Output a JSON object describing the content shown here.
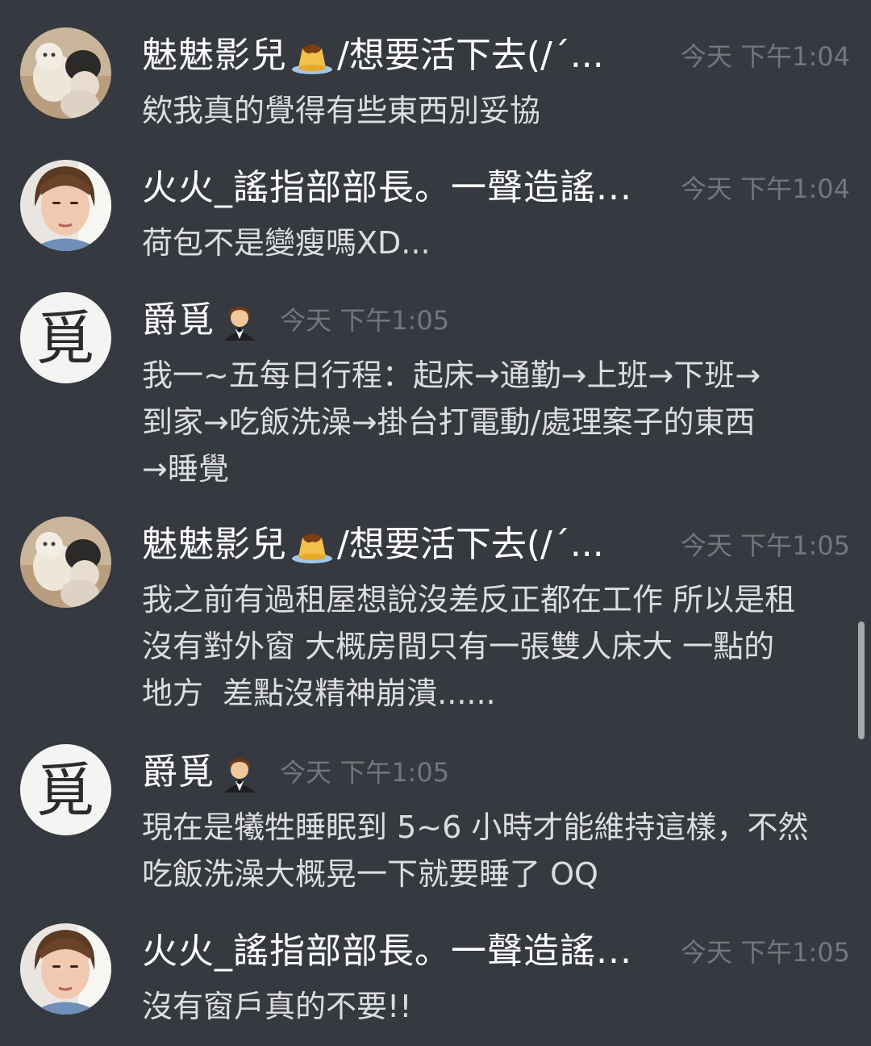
{
  "messages": [
    {
      "username": "魅魅影兒",
      "username_emoji": "pudding-emoji",
      "username_tail": " /想要活下去(/´...",
      "timestamp": "今天 下午1:04",
      "text": "欸我真的覺得有些東西別妥協",
      "avatar": "cats-avatar"
    },
    {
      "username": "火火_謠指部部長。一聲造謠...",
      "timestamp": "今天 下午1:04",
      "text": "荷包不是變瘦嗎XD...",
      "avatar": "woman-avatar"
    },
    {
      "username": "爵覓",
      "username_emoji": "man-in-tuxedo-emoji",
      "timestamp": "今天 下午1:05",
      "text": "我一~五每日行程：起床→通勤→上班→下班→\n到家→吃飯洗澡→掛台打電動/處理案子的東西\n→睡覺",
      "avatar": "calligraphy-avatar",
      "avatar_glyph": "覓"
    },
    {
      "username": "魅魅影兒",
      "username_emoji": "pudding-emoji",
      "username_tail": " /想要活下去(/´...",
      "timestamp": "今天 下午1:05",
      "text": "我之前有過租屋想說沒差反正都在工作 所以是租\n沒有對外窗 大概房間只有一張雙人床大 一點的\n地方  差點沒精神崩潰......",
      "avatar": "cats-avatar"
    },
    {
      "username": "爵覓",
      "username_emoji": "man-in-tuxedo-emoji",
      "timestamp": "今天 下午1:05",
      "text": "現在是犧牲睡眠到 5~6 小時才能維持這樣，不然\n吃飯洗澡大概晃一下就要睡了 OQ",
      "avatar": "calligraphy-avatar",
      "avatar_glyph": "覓"
    },
    {
      "username": "火火_謠指部部長。一聲造謠...",
      "timestamp": "今天 下午1:05",
      "text": "沒有窗戶真的不要!!",
      "avatar": "woman-avatar"
    }
  ],
  "colors": {
    "background": "#36393f",
    "username": "#ffffff",
    "timestamp": "#72767d",
    "message_text": "#dcddde",
    "scrollbar": "#b9bbbe"
  }
}
